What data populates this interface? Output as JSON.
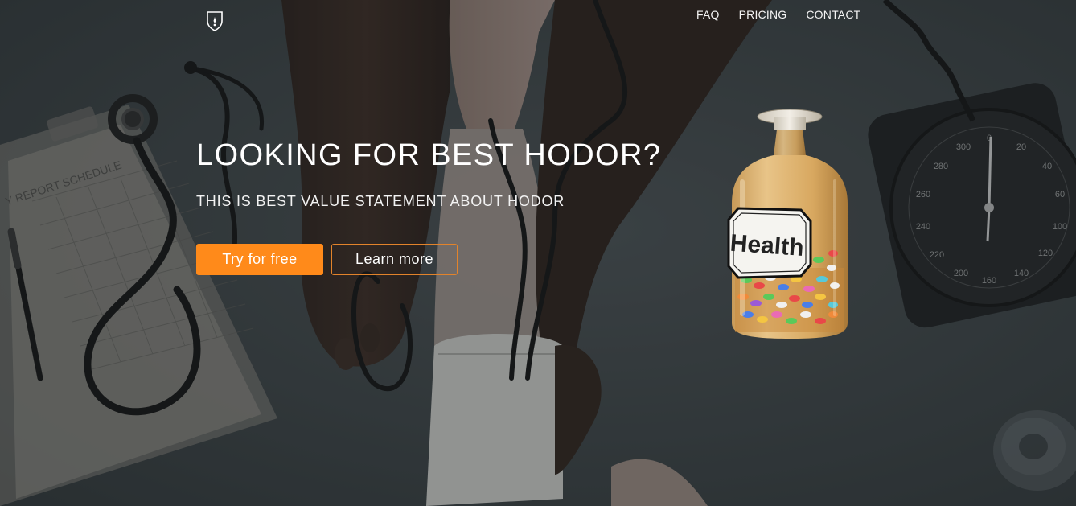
{
  "nav": {
    "logo_icon": "shield-logo-icon",
    "items": [
      {
        "label": "FAQ"
      },
      {
        "label": "PRICING"
      },
      {
        "label": "CONTACT"
      }
    ]
  },
  "hero": {
    "title": "LOOKING FOR BEST HODOR?",
    "subtitle": "THIS IS BEST VALUE STATEMENT ABOUT HODOR",
    "primary_button": "Try for free",
    "secondary_button": "Learn more",
    "bottle_label": "Health",
    "clipboard_text": "Y REPORT SCHEDULE"
  },
  "colors": {
    "accent": "#ff8a1a",
    "background": "#3a4144",
    "text": "#ffffff"
  }
}
